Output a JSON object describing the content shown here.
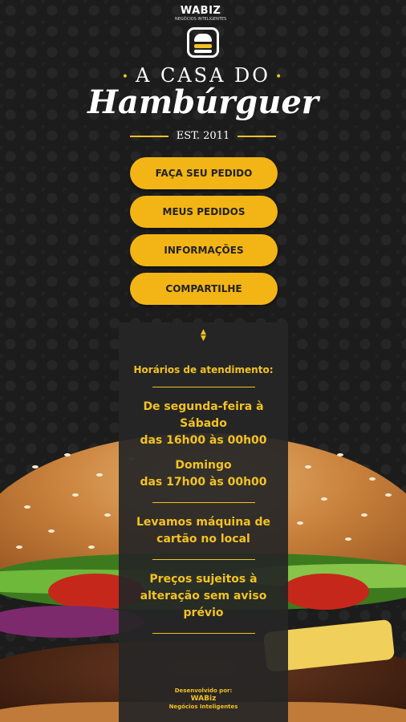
{
  "brand": {
    "wabiz": "WABIZ",
    "wabiz_tagline": "NEGÓCIOS INTELIGENTES"
  },
  "logo": {
    "title_top": "A CASA DO",
    "title_script": "Hambúrguer",
    "est": "EST. 2011"
  },
  "menu": [
    {
      "label": "FAÇA SEU PEDIDO"
    },
    {
      "label": "MEUS PEDIDOS"
    },
    {
      "label": "INFORMAÇÕES"
    },
    {
      "label": "COMPARTILHE"
    }
  ],
  "info": {
    "heading": "Horários de atendimento:",
    "weekday_days": "De segunda-feira à Sábado",
    "weekday_hours": "das 16h00 às 00h00",
    "sunday_day": "Domingo",
    "sunday_hours": "das 17h00 às 00h00",
    "card_note": "Levamos máquina de cartão no local",
    "price_note": "Preços sujeitos à alteração sem aviso prévio"
  },
  "credits": {
    "developed_by": "Desenvolvido por:",
    "name": "WABiz",
    "tagline": "Negócios Inteligentes"
  },
  "colors": {
    "accent": "#f3b515",
    "background": "#1c1c1c",
    "panel": "#262626"
  }
}
